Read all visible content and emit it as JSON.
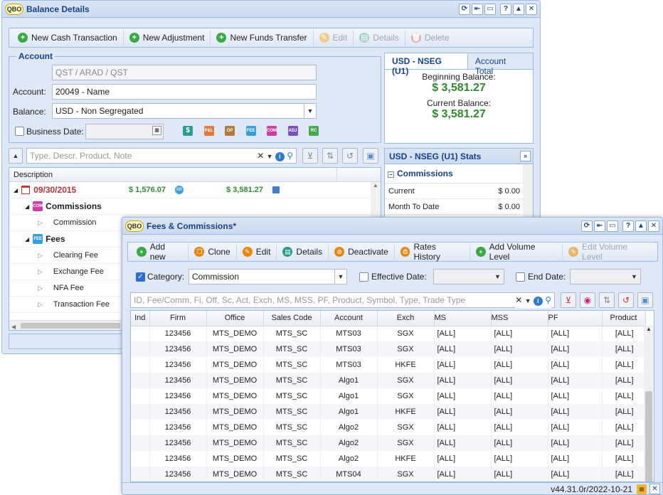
{
  "balance_window": {
    "logo": "QBO",
    "title": "Balance Details",
    "tools": [
      "⟳",
      "⇤",
      "▭",
      "?",
      "▲",
      "✕"
    ],
    "toolbar": [
      {
        "label": "New Cash Transaction",
        "icon": "+",
        "enabled": true
      },
      {
        "label": "New Adjustment",
        "icon": "+",
        "enabled": true
      },
      {
        "label": "New Funds Transfer",
        "icon": "+",
        "enabled": true
      },
      {
        "label": "Edit",
        "icon": "✎",
        "enabled": false
      },
      {
        "label": "Details",
        "icon": "▤",
        "enabled": false
      },
      {
        "label": "Delete",
        "icon": "🗑",
        "enabled": false
      }
    ],
    "account_section": {
      "title": "Account",
      "path_value": "QST / ARAD / QST",
      "account_label": "Account:",
      "account_value": "20049 - Name",
      "balance_label": "Balance:",
      "balance_value": "USD - Non Segregated",
      "business_date_label": "Business Date:",
      "business_date_value": "",
      "type_chips": [
        {
          "text": "$",
          "color": "#2b9b8a"
        },
        {
          "text": "P&L",
          "color": "#e57a38"
        },
        {
          "text": "OP",
          "color": "#b07b3c"
        },
        {
          "text": "FEE",
          "color": "#3a9fd8"
        },
        {
          "text": "COM",
          "color": "#d03ca6"
        },
        {
          "text": "ADJ",
          "color": "#7a4fb8"
        },
        {
          "text": "RC",
          "color": "#47a84c"
        }
      ]
    },
    "tabs": [
      "USD - NSEG (U1)",
      "Account Total"
    ],
    "beginning_label": "Beginning Balance:",
    "beginning_value": "$ 3,581.27",
    "current_label": "Current Balance:",
    "current_value": "$ 3,581.27",
    "search_placeholder": "Type, Descr, Product, Note",
    "tree_header": "Description",
    "tree": {
      "date": "09/30/2015",
      "amount1": "$ 1,576.07",
      "amount2": "$ 3,581.27",
      "commissions_label": "Commissions",
      "commission_item": "Commission",
      "fees_label": "Fees",
      "fee_items": [
        "Clearing Fee",
        "Exchange Fee",
        "NFA Fee",
        "Transaction Fee"
      ]
    },
    "stats": {
      "title": "USD - NSEG (U1) Stats",
      "section": "Commissions",
      "rows": [
        {
          "label": "Current",
          "value": "$ 0.00"
        },
        {
          "label": "Month To Date",
          "value": "$ 0.00"
        }
      ]
    }
  },
  "fees_window": {
    "logo": "QBO",
    "title": "Fees & Commissions*",
    "tools": [
      "⟳",
      "⇤",
      "▭",
      "?",
      "▲",
      "✕"
    ],
    "toolbar": [
      {
        "label": "Add new",
        "icon": "+",
        "color": "#3aa845",
        "enabled": true
      },
      {
        "label": "Clone",
        "icon": "❐",
        "color": "#e8860e",
        "enabled": true
      },
      {
        "label": "Edit",
        "icon": "✎",
        "color": "#e8860e",
        "enabled": true
      },
      {
        "label": "Details",
        "icon": "▤",
        "color": "#2b9b8a",
        "enabled": true
      },
      {
        "label": "Deactivate",
        "icon": "⊘",
        "color": "#e8860e",
        "enabled": true
      },
      {
        "label": "Rates History",
        "icon": "⏱",
        "color": "#e8860e",
        "enabled": true
      },
      {
        "label": "Add Volume Level",
        "icon": "+",
        "color": "#3aa845",
        "enabled": true
      },
      {
        "label": "Edit Volume Level",
        "icon": "✎",
        "color": "#e8b56a",
        "enabled": false
      }
    ],
    "category_label": "Category:",
    "category_value": "Commission",
    "effective_label": "Effective Date:",
    "end_label": "End Date:",
    "search_placeholder": "ID, Fee/Comm, Fi, Off, Sc, Act, Exch, MS, MSS, PF, Product, Symbol, Type, Trade Type",
    "columns": [
      "Ind",
      "Firm",
      "Office",
      "Sales Code",
      "Account",
      "Exch",
      "MS",
      "MSS",
      "PF",
      "Product"
    ],
    "rows": [
      [
        "",
        "123456",
        "MTS_DEMO",
        "MTS_SC",
        "MTS03",
        "SGX",
        "[ALL]",
        "[ALL]",
        "[ALL]",
        "[ALL]"
      ],
      [
        "",
        "123456",
        "MTS_DEMO",
        "MTS_SC",
        "MTS03",
        "SGX",
        "[ALL]",
        "[ALL]",
        "[ALL]",
        "[ALL]"
      ],
      [
        "",
        "123456",
        "MTS_DEMO",
        "MTS_SC",
        "MTS03",
        "HKFE",
        "[ALL]",
        "[ALL]",
        "[ALL]",
        "[ALL]"
      ],
      [
        "",
        "123456",
        "MTS_DEMO",
        "MTS_SC",
        "Algo1",
        "SGX",
        "[ALL]",
        "[ALL]",
        "[ALL]",
        "[ALL]"
      ],
      [
        "",
        "123456",
        "MTS_DEMO",
        "MTS_SC",
        "Algo1",
        "SGX",
        "[ALL]",
        "[ALL]",
        "[ALL]",
        "[ALL]"
      ],
      [
        "",
        "123456",
        "MTS_DEMO",
        "MTS_SC",
        "Algo1",
        "HKFE",
        "[ALL]",
        "[ALL]",
        "[ALL]",
        "[ALL]"
      ],
      [
        "",
        "123456",
        "MTS_DEMO",
        "MTS_SC",
        "Algo2",
        "SGX",
        "[ALL]",
        "[ALL]",
        "[ALL]",
        "[ALL]"
      ],
      [
        "",
        "123456",
        "MTS_DEMO",
        "MTS_SC",
        "Algo2",
        "SGX",
        "[ALL]",
        "[ALL]",
        "[ALL]",
        "[ALL]"
      ],
      [
        "",
        "123456",
        "MTS_DEMO",
        "MTS_SC",
        "Algo2",
        "HKFE",
        "[ALL]",
        "[ALL]",
        "[ALL]",
        "[ALL]"
      ],
      [
        "",
        "123456",
        "MTS_DEMO",
        "MTS_SC",
        "MTS04",
        "SGX",
        "[ALL]",
        "[ALL]",
        "[ALL]",
        "[ALL]"
      ]
    ],
    "version": "v44.31.0r/2022-10-21"
  }
}
